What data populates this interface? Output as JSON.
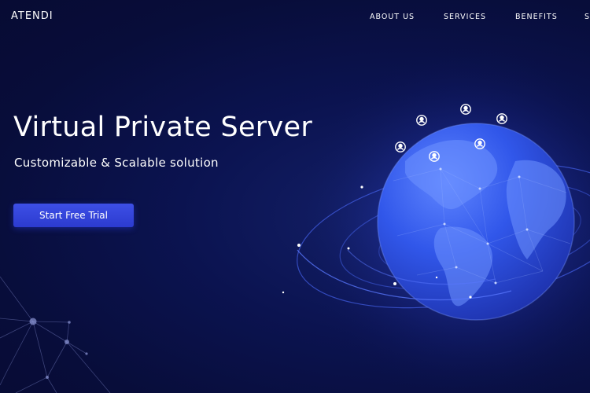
{
  "header": {
    "logo": "ATENDI",
    "nav": [
      {
        "label": "ABOUT US"
      },
      {
        "label": "SERVICES"
      },
      {
        "label": "BENEFITS"
      },
      {
        "label": "S"
      }
    ]
  },
  "hero": {
    "title": "Virtual Private Server",
    "subtitle": "Customizable & Scalable solution",
    "cta_label": "Start Free Trial"
  },
  "colors": {
    "background": "#080d3a",
    "accent": "#3346e0",
    "globe": "#2f56e8"
  },
  "icons": [
    "user-icon",
    "globe-illustration",
    "network-graph"
  ]
}
